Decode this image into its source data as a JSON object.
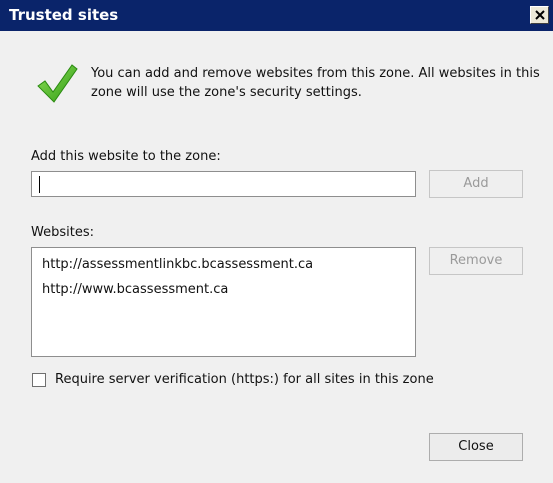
{
  "window": {
    "title": "Trusted sites",
    "close_glyph": "✕"
  },
  "info": {
    "icon": "check-mark-icon",
    "text": "You can add and remove websites from this zone. All websites in this zone will use the zone's security settings."
  },
  "add_section": {
    "label": "Add this website to the zone:",
    "input_value": "",
    "add_label": "Add"
  },
  "websites": {
    "label": "Websites:",
    "items": [
      "http://assessmentlinkbc.bcassessment.ca",
      "http://www.bcassessment.ca"
    ],
    "remove_label": "Remove"
  },
  "https_option": {
    "label": "Require server verification (https:) for all sites in this zone",
    "checked": false
  },
  "footer": {
    "close_label": "Close"
  },
  "colors": {
    "titlebar": "#0a246a",
    "check_green": "#4caf1e"
  }
}
